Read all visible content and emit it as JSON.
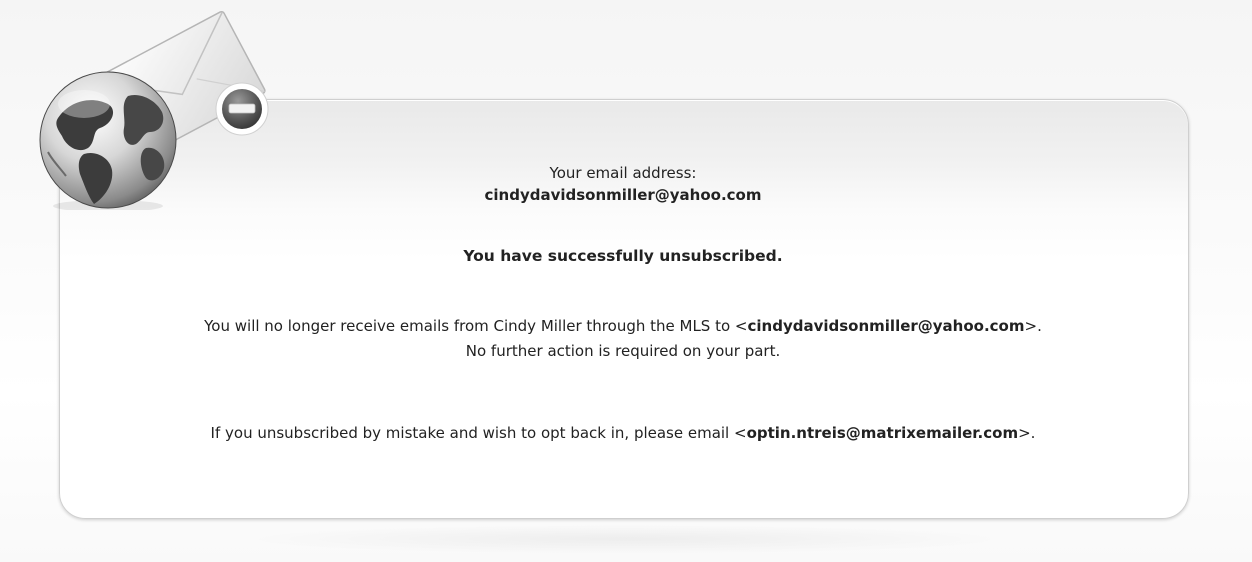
{
  "status": {
    "email_label": "Your email address:",
    "email_address": "cindydavidsonmiller@yahoo.com",
    "success_message": "You have successfully unsubscribed."
  },
  "notice": {
    "line1_prefix": "You will no longer receive emails from Cindy Miller through the MLS to <",
    "line1_email": "cindydavidsonmiller@yahoo.com",
    "line1_suffix": ">.",
    "line2": "No further action is required on your part."
  },
  "optin": {
    "prefix": "If you unsubscribed by mistake and wish to opt back in, please email <",
    "email": "optin.ntreis@matrixemailer.com",
    "suffix": ">."
  },
  "icons": {
    "globe": "globe-icon",
    "envelope": "envelope-icon",
    "remove": "remove-circle-icon"
  }
}
